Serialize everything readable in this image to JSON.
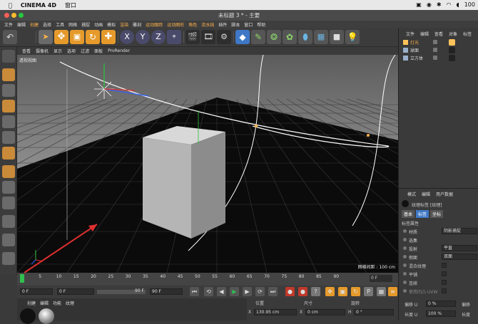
{
  "mac_menu": {
    "app_name": "CINEMA 4D",
    "menu_window": "窗口",
    "battery": "100"
  },
  "window": {
    "title": "未标题 3 * - 主要"
  },
  "menu": [
    "文件",
    "编辑",
    "创建",
    "选择",
    "工具",
    "网格",
    "捕捉",
    "动画",
    "模拟",
    "渲染",
    "雕刻",
    "运动跟踪",
    "运动图形",
    "角色",
    "流水线",
    "插件",
    "脚本",
    "窗口",
    "帮助"
  ],
  "viewport": {
    "menu": [
      "查看",
      "摄像机",
      "显示",
      "选项",
      "过滤",
      "面板",
      "ProRender"
    ],
    "label": "透视视图",
    "grid_spacing": "网格间距 : 100 cm"
  },
  "timeline": {
    "ticks": [
      "0",
      "5",
      "10",
      "15",
      "20",
      "25",
      "30",
      "35",
      "40",
      "45",
      "50",
      "55",
      "60",
      "65",
      "70",
      "75",
      "80",
      "85",
      "90"
    ],
    "frame_end": "0 F"
  },
  "playback": {
    "start": "0 F",
    "current": "0 F",
    "end": "90 F",
    "max": "90 F"
  },
  "bottom": {
    "tabs": [
      "创建",
      "编辑",
      "功能",
      "纹理"
    ],
    "coord_headers": [
      "位置",
      "尺寸",
      "旋转"
    ],
    "x_label": "X",
    "x_pos": "130.95 cm",
    "x_size": "0 cm",
    "h_label": "H",
    "h_rot": "0 °"
  },
  "object_panel": {
    "tabs": [
      "文件",
      "编辑",
      "查看",
      "对象",
      "标签"
    ],
    "items": [
      {
        "name": "灯光",
        "color": "#ffc25a"
      },
      {
        "name": "球面",
        "color": "#9ab0cc"
      },
      {
        "name": "立方体",
        "color": "#9ab0cc"
      }
    ]
  },
  "attr_panel": {
    "tabs": [
      "模式",
      "编辑",
      "用户数据"
    ],
    "title": "纹理标签 [纹理]",
    "subtabs": [
      "基本",
      "标签",
      "坐标"
    ],
    "section": "标签属性",
    "rows": [
      {
        "label": "材质",
        "value": "阴影捕捉"
      },
      {
        "label": "选集",
        "value": ""
      },
      {
        "label": "投射",
        "value": "平直"
      },
      {
        "label": "侧面",
        "value": "双面"
      },
      {
        "label": "混合纹理",
        "value": ""
      },
      {
        "label": "平铺",
        "value": ""
      },
      {
        "label": "连续",
        "value": ""
      },
      {
        "label": "使用凹凸 UVW",
        "value": ""
      }
    ],
    "offset_u_label": "偏移 U",
    "offset_u": "0 %",
    "offset_v_label": "偏移",
    "length_u_label": "长度 U",
    "length_u": "100 %",
    "length_v_label": "长度"
  },
  "colors": {
    "accent": "#ffb24a",
    "cube_top": "#d8d8d8",
    "cube_front": "#b5b5b5",
    "cube_side": "#8c8c8c",
    "spline": "#ffffff",
    "arrow": "#e03030"
  }
}
